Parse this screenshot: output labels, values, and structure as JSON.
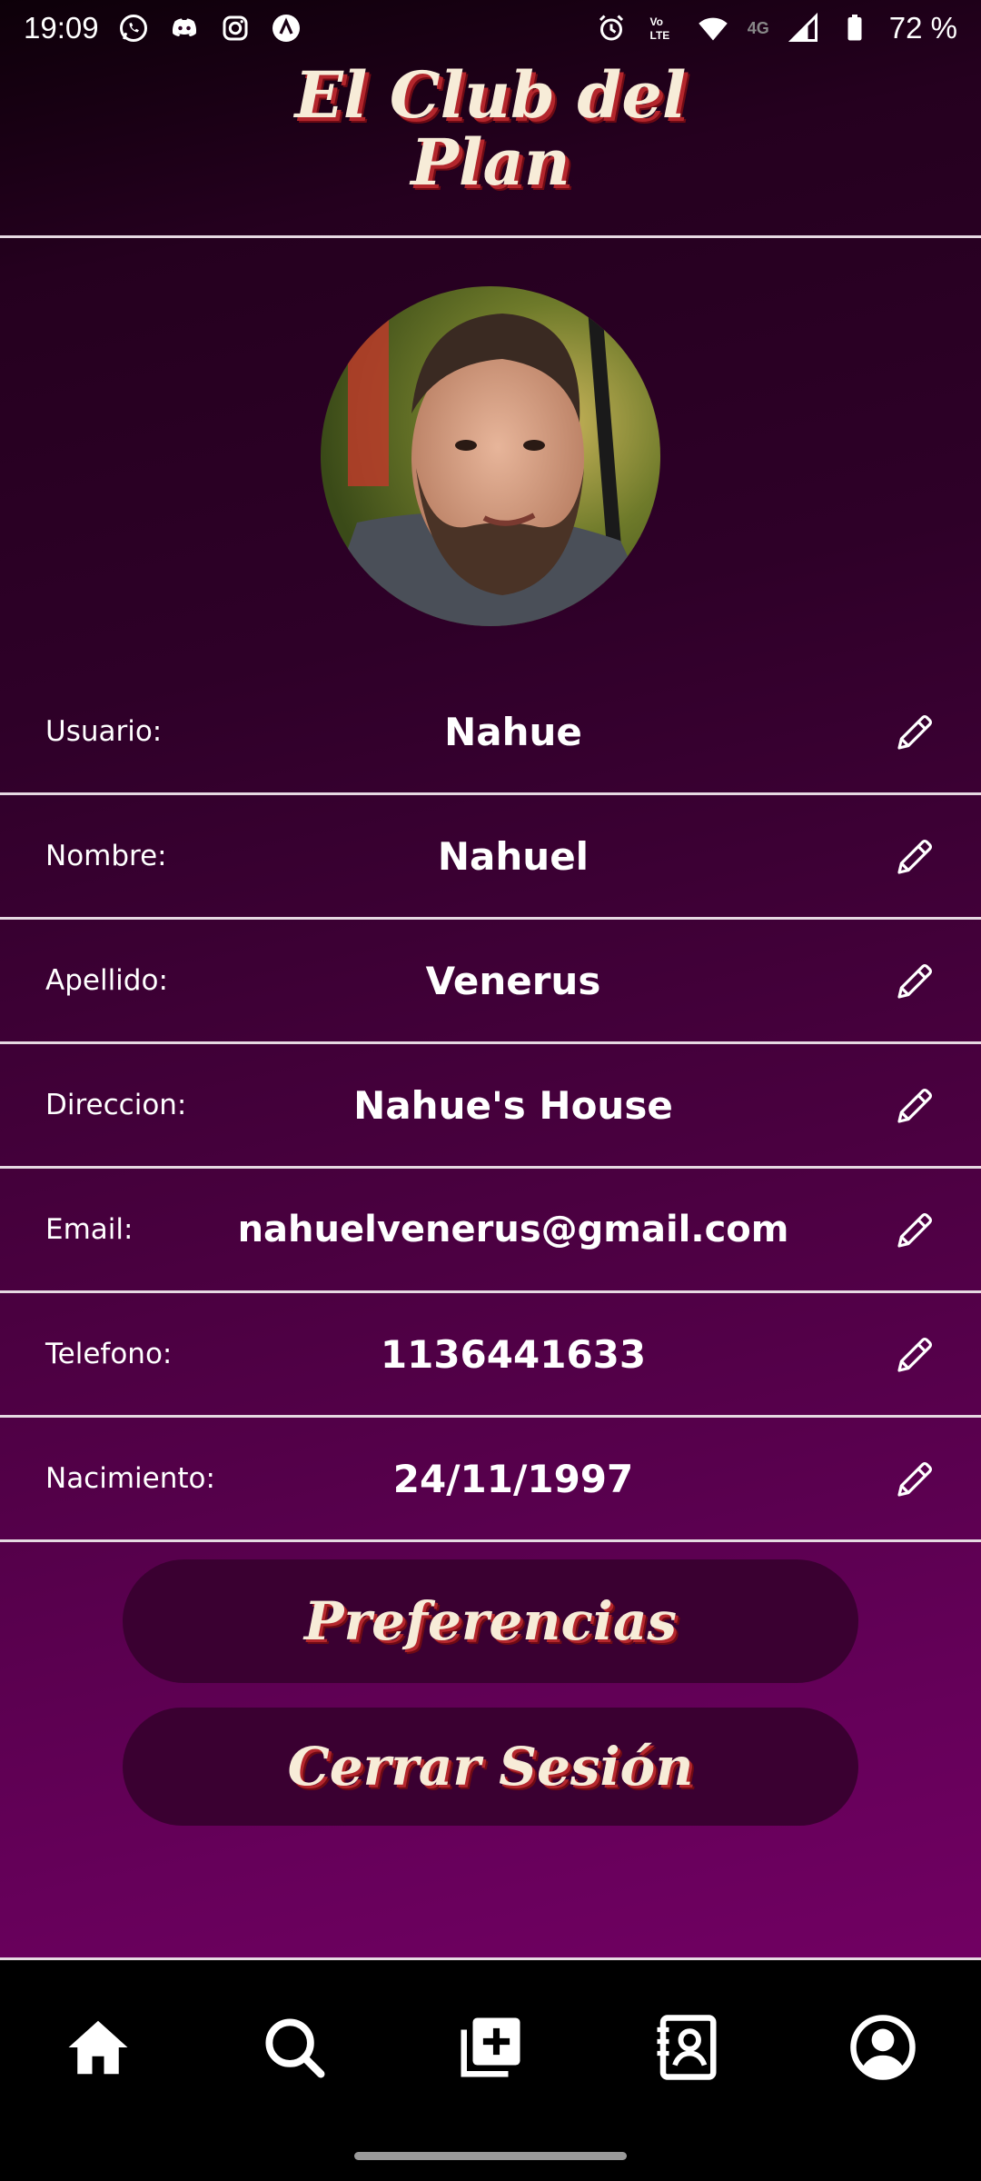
{
  "status_bar": {
    "time": "19:09",
    "battery": "72 %",
    "network": "4G",
    "icons": [
      "whatsapp-icon",
      "discord-icon",
      "instagram-icon",
      "app-icon",
      "alarm-icon",
      "volte-icon",
      "wifi-icon",
      "signal-icon",
      "battery-icon"
    ]
  },
  "header": {
    "title_line1": "El Club del",
    "title_line2": "Plan"
  },
  "profile": {
    "fields": [
      {
        "label": "Usuario:",
        "value": "Nahue"
      },
      {
        "label": "Nombre:",
        "value": "Nahuel"
      },
      {
        "label": "Apellido:",
        "value": "Venerus"
      },
      {
        "label": "Direccion:",
        "value": "Nahue's House"
      },
      {
        "label": "Email:",
        "value": "nahuelvenerus@gmail.com"
      },
      {
        "label": "Telefono:",
        "value": "1136441633"
      },
      {
        "label": "Nacimiento:",
        "value": "24/11/1997"
      }
    ]
  },
  "buttons": {
    "preferences": "Preferencias",
    "logout": "Cerrar Sesión"
  },
  "bottom_nav": {
    "items": [
      "home-icon",
      "search-icon",
      "add-post-icon",
      "contacts-icon",
      "profile-icon"
    ]
  },
  "colors": {
    "title_cream": "#f7ecd8",
    "title_shadow_red": "#b3262c",
    "button_bg": "#3a0031",
    "divider": "#e6d9e2"
  }
}
